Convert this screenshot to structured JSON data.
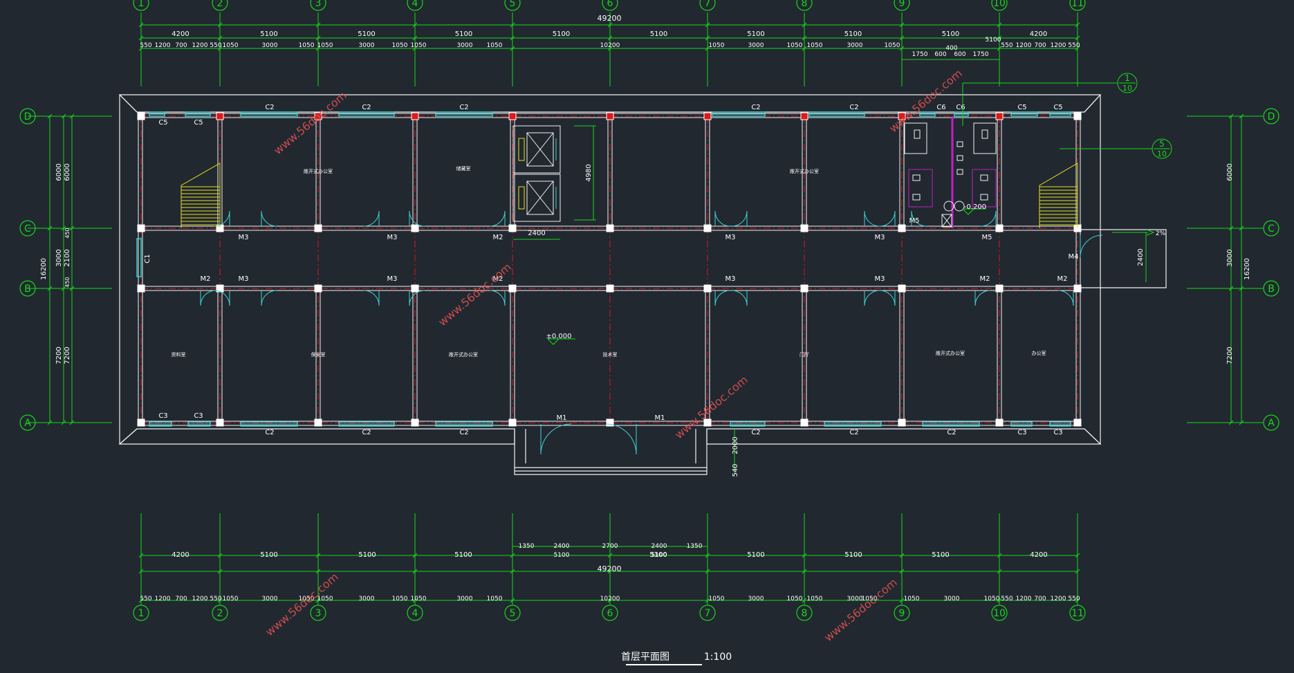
{
  "colors": {
    "background": "#212830",
    "dimension": "#18d818",
    "wall": "#f2f2f2",
    "axis": "#e01818",
    "window": "#3fd3d3",
    "stair": "#e6e020",
    "text": "#ffffff",
    "accent": "#c020c0",
    "watermark": "#e05050"
  },
  "axes": {
    "columns": [
      "1",
      "2",
      "3",
      "4",
      "5",
      "6",
      "7",
      "8",
      "9",
      "10",
      "11"
    ],
    "rows": [
      "D",
      "C",
      "B",
      "A"
    ]
  },
  "dimensions": {
    "top_total": "49200",
    "top_bays": [
      "4200",
      "5100",
      "5100",
      "5100",
      "5100",
      "5100",
      "5100",
      "5100",
      "5100",
      "4200"
    ],
    "top_detail": [
      "550",
      "1200",
      "700",
      "1200",
      "550",
      "1050",
      "3000",
      "1050",
      "1050",
      "3000",
      "1050",
      "1050",
      "3000",
      "1050",
      "10200",
      "1050",
      "3000",
      "1050",
      "1050",
      "3000",
      "1050",
      "550",
      "1200",
      "700",
      "1200",
      "550"
    ],
    "top_extra": [
      "1750",
      "600",
      "600",
      "1750",
      "400",
      "5100"
    ],
    "bottom_total": "49200",
    "bottom_bays": [
      "4200",
      "5100",
      "5100",
      "5100",
      "5100",
      "5100",
      "5100",
      "5100",
      "4200"
    ],
    "bottom_entry": [
      "1350",
      "2400",
      "2700",
      "2400",
      "1350"
    ],
    "bottom_detail": [
      "550",
      "1200",
      "700",
      "1200",
      "550",
      "1050",
      "3000",
      "1050",
      "1050",
      "3000",
      "1050",
      "1050",
      "3000",
      "1050",
      "10200",
      "1050",
      "3000",
      "1050",
      "1050",
      "3000",
      "1050",
      "1050",
      "3000",
      "1050",
      "550",
      "1200",
      "700",
      "1200",
      "550"
    ],
    "left_outer": "16200",
    "left_rows": [
      "6000",
      "3000",
      "7200"
    ],
    "left_inner": [
      "6000",
      "2100",
      "7200"
    ],
    "left_small": [
      "450",
      "450"
    ],
    "right_outer": "16200",
    "right_rows": [
      "6000",
      "3000",
      "7200"
    ],
    "elevator": "4980",
    "stair_width": "2400",
    "ramp": "2400",
    "porch": [
      "2000",
      "540"
    ]
  },
  "windows": {
    "top": [
      "C5",
      "C5",
      "C2",
      "C2",
      "C2",
      "C2",
      "C2",
      "C6",
      "C6",
      "C5",
      "C5"
    ],
    "bottom": [
      "C3",
      "C3",
      "C2",
      "C2",
      "C2",
      "C2",
      "C2",
      "C2",
      "C3",
      "C3"
    ],
    "side": "C1"
  },
  "doors": [
    "M3",
    "M3",
    "M2",
    "M3",
    "M3",
    "M5",
    "M5",
    "M2",
    "M3",
    "M3",
    "M2",
    "M3",
    "M3",
    "M2",
    "M2",
    "M4",
    "M1",
    "M1"
  ],
  "rooms": [
    "敞开式办公室",
    "储藏室",
    "敞开式办公室",
    "保安室",
    "敞开式办公室",
    "技术室",
    "门厅",
    "敞开式办公室",
    "办公室",
    "资料室"
  ],
  "levels": {
    "hall": "±0.000",
    "toilet": "-0.200"
  },
  "callouts": [
    {
      "num": "1",
      "den": "10"
    },
    {
      "num": "5",
      "den": "10"
    }
  ],
  "slope_label": "2%",
  "title": "首层平面图",
  "scale": "1:100",
  "watermark": "www.56doc.com"
}
